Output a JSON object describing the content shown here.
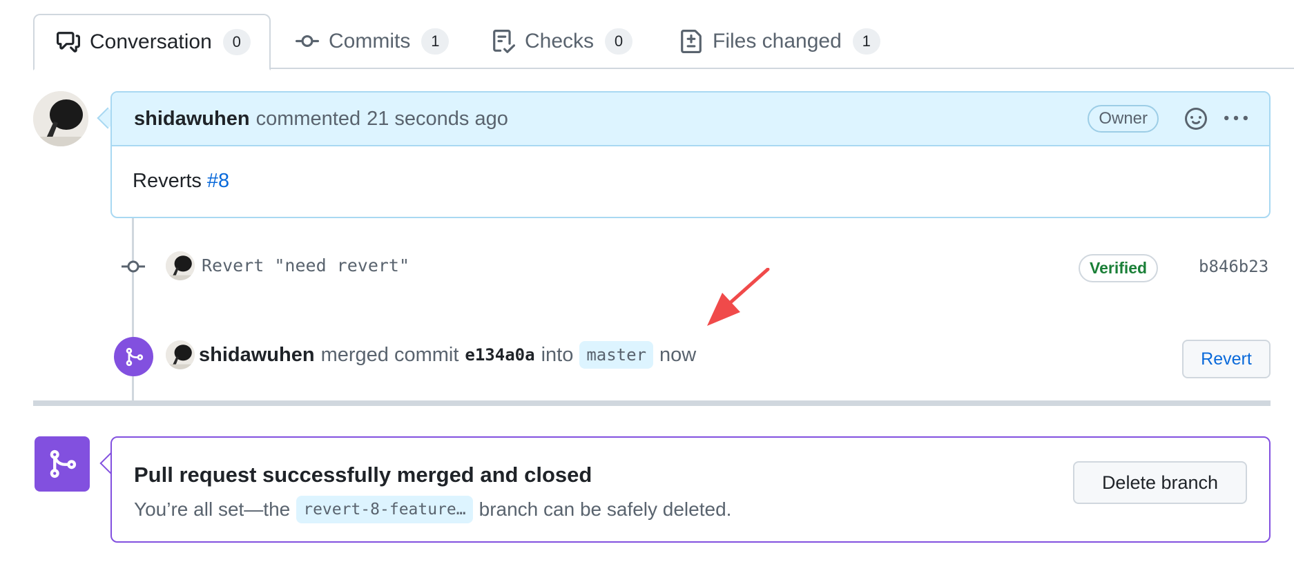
{
  "tabs": [
    {
      "label": "Conversation",
      "count": "0",
      "icon": "comment-discussion-icon",
      "active": true
    },
    {
      "label": "Commits",
      "count": "1",
      "icon": "git-commit-icon"
    },
    {
      "label": "Checks",
      "count": "0",
      "icon": "checklist-icon"
    },
    {
      "label": "Files changed",
      "count": "1",
      "icon": "file-diff-icon"
    }
  ],
  "comment": {
    "author": "shidawuhen",
    "action": "commented",
    "time": "21 seconds ago",
    "badge": "Owner",
    "body_text": "Reverts",
    "body_link": "#8"
  },
  "commit": {
    "message": "Revert \"need revert\"",
    "verified": "Verified",
    "sha": "b846b23"
  },
  "merge_event": {
    "author": "shidawuhen",
    "text_merged": "merged commit",
    "sha": "e134a0a",
    "text_into": "into",
    "branch": "master",
    "time": "now",
    "revert_label": "Revert"
  },
  "merged_box": {
    "title": "Pull request successfully merged and closed",
    "sub_before": "You’re all set—the",
    "branch": "revert-8-feature…",
    "sub_after": "branch can be safely deleted.",
    "delete_label": "Delete branch"
  },
  "colors": {
    "accent_blue": "#0969da",
    "merged_purple": "#8250df",
    "verified_green": "#1a7f37",
    "comment_header_bg": "#ddf4ff",
    "annotation_red": "#f04a4a"
  }
}
